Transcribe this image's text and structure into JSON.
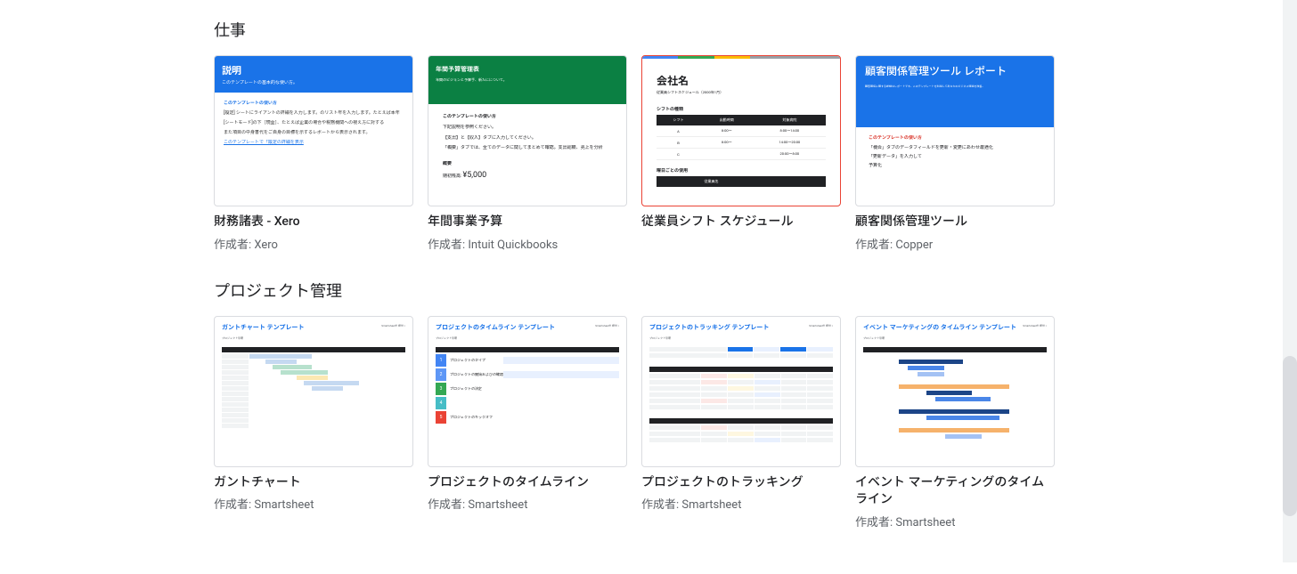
{
  "sections": {
    "work": {
      "title": "仕事",
      "templates": [
        {
          "title": "財務諸表 - Xero",
          "author": "作成者: Xero",
          "thumb": {
            "header_title": "説明",
            "header_sub": "このテンプレートの基本的な使い方。",
            "body_heading": "このテンプレートの使い方",
            "items": [
              "[設定] シートにライアントの詳細を入力します。のリスト年を入力します。たとえば本年",
              "[シートモード]の下［現金］、たとえば企業の場合や税務機関への視え方に対する",
              "また項目の中身書代をご自身の目標を示するレポートから表示されます。",
              "このテンプレートで「設定の詳細を表示"
            ]
          }
        },
        {
          "title": "年間事業予算",
          "author": "作成者: Intuit Quickbooks",
          "thumb": {
            "header_title": "年間予算管理表",
            "header_sub": "年間のビジョンと予算手、新たにについて。",
            "body_heading": "このテンプレートの使い方",
            "items": [
              "下記説明を参照ください。",
              "【支出】と【収入】タブに入力してください。",
              "「概要」タブでは、全てのデータに関してまとめて確認。支出総額、売上を分析"
            ],
            "footer_label": "概要",
            "footer_sublabel": "期初残高:",
            "footer_amount": "¥5,000"
          }
        },
        {
          "title": "従業員シフト スケジュール",
          "author": "",
          "highlighted": true,
          "thumb": {
            "company": "会社名",
            "sub": "従業員シフトスケジュール（2000年1月）",
            "section1": "シフトの種類",
            "table_headers": [
              "シフト",
              "出勤時間",
              "対象病院"
            ],
            "table_rows": [
              [
                "A",
                "8:00〜",
                "8:00〜14:00"
              ],
              [
                "B",
                "8:00〜",
                "14:00〜20:00"
              ],
              [
                "C",
                "",
                "20:00〜8:00"
              ]
            ],
            "section2": "曜日ごとの使用",
            "footer_header": "従業員名"
          }
        },
        {
          "title": "顧客関係管理ツール",
          "author": "作成者: Copper",
          "thumb": {
            "header_title": "顧客関係管理ツール レポート",
            "header_sub": "顧客関係に関する詳細なレポートです。このテンプレートを利用してあなたのビジネス環境を改善。",
            "body_heading": "このテンプレートの使い方",
            "items": [
              "「機会」タブのデータフィールドを更新・変更にあわせ最適化",
              "「更新データ」を入力して",
              "予算化"
            ]
          }
        }
      ]
    },
    "project": {
      "title": "プロジェクト管理",
      "templates": [
        {
          "title": "ガントチャート",
          "author": "作成者: Smartsheet",
          "thumb": {
            "heading": "ガントチャート テンプレート",
            "meta_label": "Smartsheet® 提供 »",
            "sub": "プロジェクト管理"
          }
        },
        {
          "title": "プロジェクトのタイムライン",
          "author": "作成者: Smartsheet",
          "thumb": {
            "heading": "プロジェクトのタイムライン テンプレート",
            "meta_label": "Smartsheet® 提供 »",
            "sub": "プロジェクト管理",
            "row1": "プロジェクトのタイプ",
            "row2": "プロジェクトの開始およびの確認",
            "row3": "プロジェクトの決定",
            "row4": "プロジェクトのキックオフ"
          }
        },
        {
          "title": "プロジェクトのトラッキング",
          "author": "作成者: Smartsheet",
          "thumb": {
            "heading": "プロジェクトのトラッキング テンプレート",
            "meta_label": "Smartsheet® 提供 »",
            "sub": "プロジェクト管理"
          }
        },
        {
          "title": "イベント マーケティングのタイムライン",
          "author": "作成者: Smartsheet",
          "thumb": {
            "heading": "イベント マーケティングの タイムライン テンプレート",
            "meta_label": "Smartsheet® 提供 »",
            "sub": "プロジェクト管理"
          }
        }
      ]
    }
  }
}
